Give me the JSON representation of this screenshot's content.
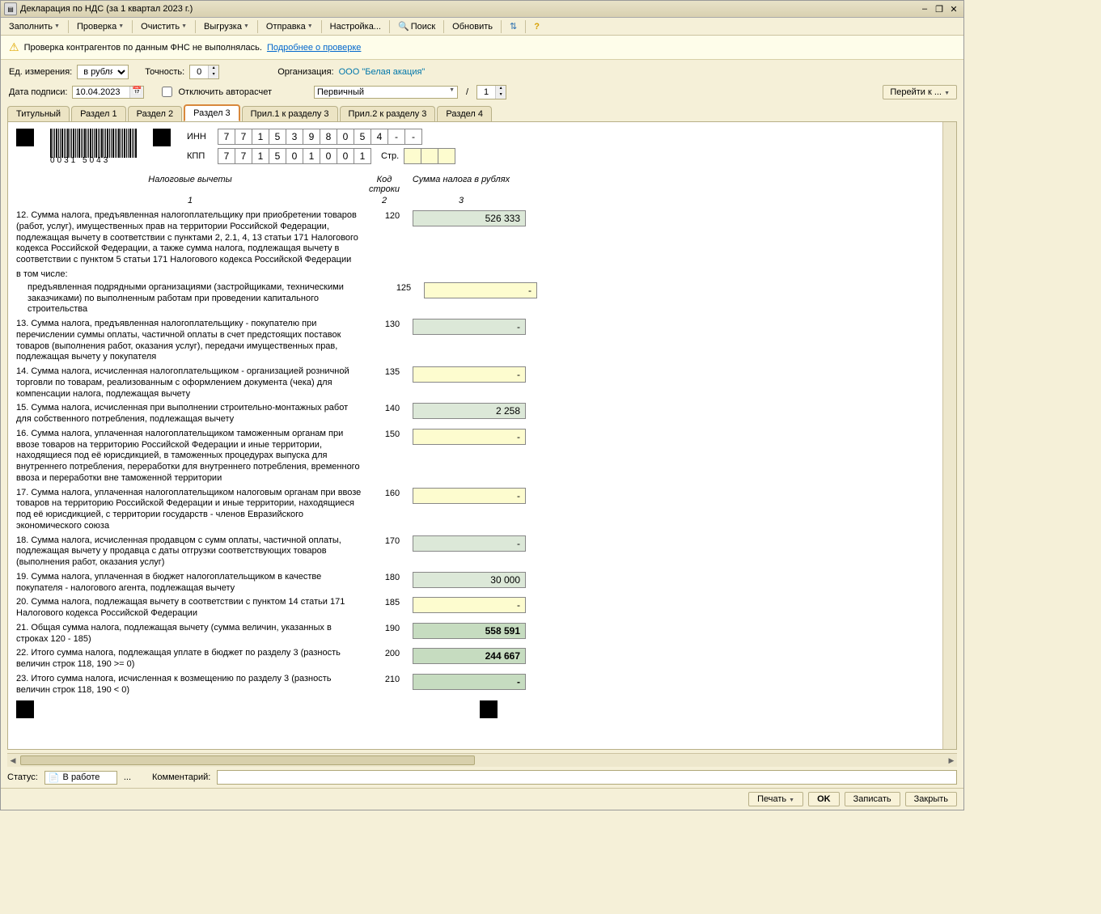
{
  "title": "Декларация по НДС (за 1 квартал 2023 г.)",
  "toolbar": {
    "fill": "Заполнить",
    "check": "Проверка",
    "clear": "Очистить",
    "export": "Выгрузка",
    "send": "Отправка",
    "settings": "Настройка...",
    "search": "Поиск",
    "refresh": "Обновить"
  },
  "warning": {
    "text": "Проверка контрагентов по данным ФНС не выполнялась.",
    "link": "Подробнее о проверке"
  },
  "params": {
    "units_label": "Ед. измерения:",
    "units_value": "в рублях",
    "precision_label": "Точность:",
    "precision_value": "0",
    "org_label": "Организация:",
    "org_value": "ООО \"Белая акация\"",
    "date_label": "Дата подписи:",
    "date_value": "10.04.2023",
    "autocalc": "Отключить авторасчет",
    "doc_type": "Первичный",
    "corr_sep": "/",
    "corr_value": "1",
    "goto": "Перейти к ..."
  },
  "tabs": [
    "Титульный",
    "Раздел 1",
    "Раздел 2",
    "Раздел 3",
    "Прил.1 к разделу 3",
    "Прил.2 к разделу 3",
    "Раздел 4"
  ],
  "active_tab": "Раздел 3",
  "doc": {
    "barcode_text": "0031 5043",
    "inn_label": "ИНН",
    "inn": [
      "7",
      "7",
      "1",
      "5",
      "3",
      "9",
      "8",
      "0",
      "5",
      "4",
      "-",
      "-"
    ],
    "kpp_label": "КПП",
    "kpp": [
      "7",
      "7",
      "1",
      "5",
      "0",
      "1",
      "0",
      "0",
      "1"
    ],
    "page_label": "Стр.",
    "headers": {
      "h1": "Налоговые вычеты",
      "h2": "Код строки",
      "h3": "Сумма налога в рублях",
      "c1": "1",
      "c2": "2",
      "c3": "3"
    }
  },
  "rows": [
    {
      "desc": "12. Сумма налога, предъявленная налогоплательщику при приобретении товаров (работ, услуг), имущественных прав на территории Российской Федерации, подлежащая вычету в соответствии с пунктами 2, 2.1, 4, 13 статьи 171 Налогового кодекса Российской Федерации, а также сумма налога, подлежащая вычету в соответствии с пунктом 5 статьи 171 Налогового кодекса Российской Федерации",
      "code": "120",
      "sum": "526 333",
      "cls": "sg"
    },
    {
      "desc": "в том числе:",
      "intom": true
    },
    {
      "desc": "предъявленная подрядными организациями (застройщиками, техническими заказчиками) по выполненным работам при проведении капитального строительства",
      "code": "125",
      "sum": "-",
      "cls": "sy",
      "sub": true
    },
    {
      "desc": "13. Сумма налога, предъявленная налогоплательщику - покупателю при перечислении суммы оплаты, частичной оплаты в счет предстоящих поставок товаров (выполнения работ, оказания услуг), передачи имущественных прав, подлежащая вычету у покупателя",
      "code": "130",
      "sum": "-",
      "cls": "sg"
    },
    {
      "desc": "14. Сумма налога, исчисленная налогоплательщиком - организацией розничной торговли по товарам, реализованным с оформлением документа (чека) для компенсации налога, подлежащая вычету",
      "code": "135",
      "sum": "-",
      "cls": "sy"
    },
    {
      "desc": "15. Сумма налога, исчисленная при выполнении строительно-монтажных работ для собственного потребления, подлежащая вычету",
      "code": "140",
      "sum": "2 258",
      "cls": "sg"
    },
    {
      "desc": "16. Сумма налога, уплаченная налогоплательщиком таможенным органам при ввозе товаров на территорию Российской Федерации и иные территории, находящиеся под её юрисдикцией, в таможенных процедурах выпуска для внутреннего потребления, переработки для внутреннего потребления, временного ввоза и переработки вне таможенной территории",
      "code": "150",
      "sum": "-",
      "cls": "sy"
    },
    {
      "desc": "17. Сумма налога, уплаченная налогоплательщиком налоговым органам при ввозе товаров на территорию Российской Федерации и иные территории, находящиеся под её юрисдикцией, с территории государств - членов Евразийского экономического союза",
      "code": "160",
      "sum": "-",
      "cls": "sy"
    },
    {
      "desc": "18. Сумма налога, исчисленная продавцом с сумм оплаты, частичной оплаты, подлежащая вычету у продавца с даты отгрузки соответствующих товаров (выполнения работ, оказания услуг)",
      "code": "170",
      "sum": "-",
      "cls": "sg"
    },
    {
      "desc": "19. Сумма налога, уплаченная в бюджет налогоплательщиком в качестве покупателя - налогового агента, подлежащая вычету",
      "code": "180",
      "sum": "30 000",
      "cls": "sg"
    },
    {
      "desc": "20. Сумма налога, подлежащая вычету в соответствии с пунктом 14 статьи 171 Налогового кодекса Российской Федерации",
      "code": "185",
      "sum": "-",
      "cls": "sy"
    },
    {
      "desc": "21. Общая сумма налога, подлежащая вычету (сумма величин, указанных в строках 120 - 185)",
      "code": "190",
      "sum": "558 591",
      "cls": "sdg"
    },
    {
      "desc": "22. Итого сумма налога, подлежащая уплате в бюджет по разделу 3 (разность величин строк 118, 190 >= 0)",
      "code": "200",
      "sum": "244 667",
      "cls": "sdg"
    },
    {
      "desc": "23. Итого сумма налога, исчисленная к возмещению по разделу 3 (разность величин строк 118, 190 < 0)",
      "code": "210",
      "sum": "-",
      "cls": "sdg"
    }
  ],
  "status": {
    "label": "Статус:",
    "value": "В работе",
    "ellipsis": "...",
    "comment_label": "Комментарий:"
  },
  "bottom": {
    "print": "Печать",
    "ok": "OK",
    "save": "Записать",
    "close": "Закрыть"
  }
}
